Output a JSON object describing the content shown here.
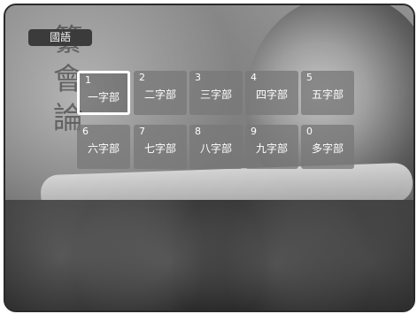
{
  "header": {
    "language_tab": "國語"
  },
  "grid": {
    "selected_index": 0,
    "cells": [
      {
        "num": "1",
        "label": "一字部"
      },
      {
        "num": "2",
        "label": "二字部"
      },
      {
        "num": "3",
        "label": "三字部"
      },
      {
        "num": "4",
        "label": "四字部"
      },
      {
        "num": "5",
        "label": "五字部"
      },
      {
        "num": "6",
        "label": "六字部"
      },
      {
        "num": "7",
        "label": "七字部"
      },
      {
        "num": "8",
        "label": "八字部"
      },
      {
        "num": "9",
        "label": "九字部"
      },
      {
        "num": "0",
        "label": "多字部"
      }
    ]
  }
}
